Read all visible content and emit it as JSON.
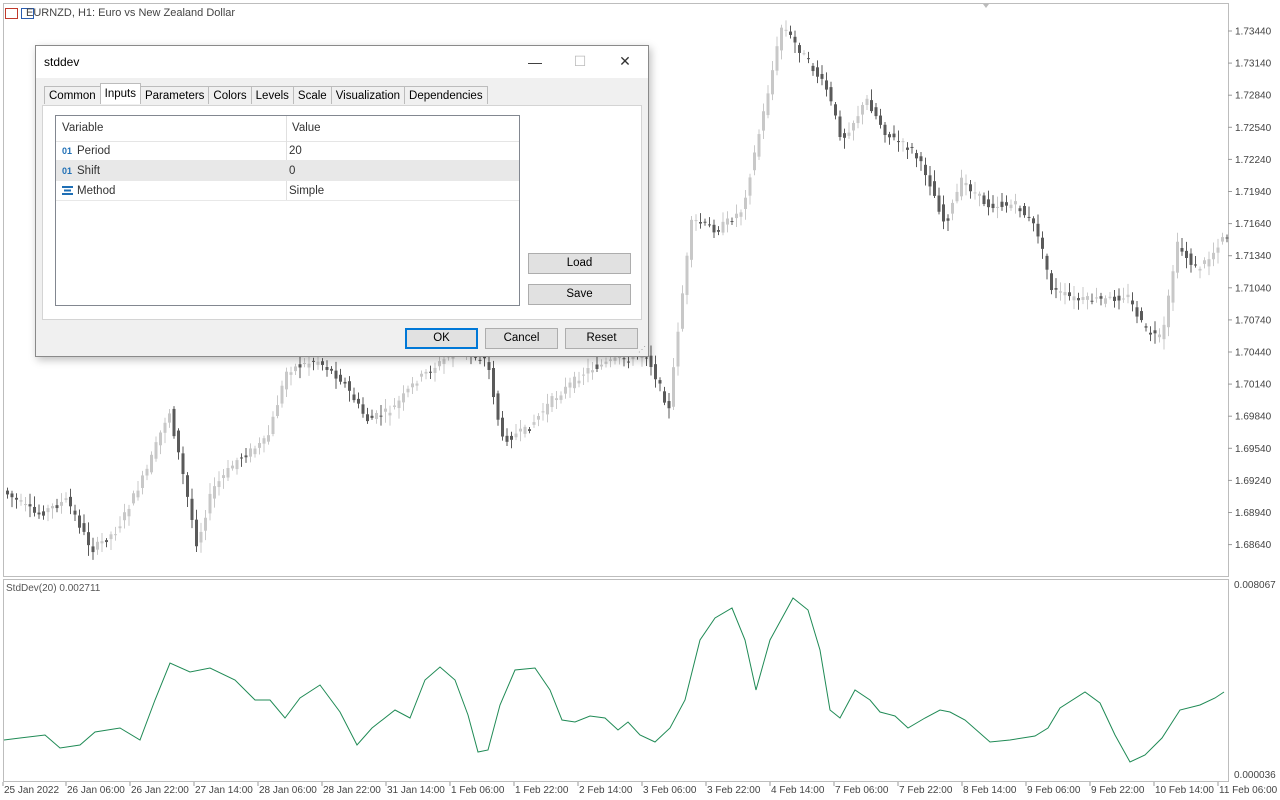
{
  "chart": {
    "symbol_title": "EURNZD, H1:  Euro vs New Zealand Dollar",
    "price_axis_labels": [
      "1.73440",
      "1.73140",
      "1.72840",
      "1.72540",
      "1.72240",
      "1.71940",
      "1.71640",
      "1.71340",
      "1.71040",
      "1.70740",
      "1.70440",
      "1.70140",
      "1.69840",
      "1.69540",
      "1.69240",
      "1.68940",
      "1.68640"
    ],
    "indicator_label": "StdDev(20) 0.002711",
    "indicator_axis_max": "0.008067",
    "indicator_axis_min": "0.000036",
    "time_labels": [
      "25 Jan 2022",
      "26 Jan 06:00",
      "26 Jan 22:00",
      "27 Jan 14:00",
      "28 Jan 06:00",
      "28 Jan 22:00",
      "31 Jan 14:00",
      "1 Feb 06:00",
      "1 Feb 22:00",
      "2 Feb 14:00",
      "3 Feb 06:00",
      "3 Feb 22:00",
      "4 Feb 14:00",
      "7 Feb 06:00",
      "7 Feb 22:00",
      "8 Feb 14:00",
      "9 Feb 06:00",
      "9 Feb 22:00",
      "10 Feb 14:00",
      "11 Feb 06:00"
    ],
    "colors": {
      "up": "#c8c8c8",
      "down": "#5a5a5a",
      "indicator_line": "#1f8a55",
      "grid_border": "#c8c8c8"
    }
  },
  "dialog": {
    "title": "stddev",
    "tabs": [
      "Common",
      "Inputs",
      "Parameters",
      "Colors",
      "Levels",
      "Scale",
      "Visualization",
      "Dependencies"
    ],
    "active_tab": "Inputs",
    "table": {
      "headers": [
        "Variable",
        "Value"
      ],
      "rows": [
        {
          "icon": "int-icon",
          "icon_text": "01",
          "variable": "Period",
          "value": "20"
        },
        {
          "icon": "int-icon",
          "icon_text": "01",
          "variable": "Shift",
          "value": "0"
        },
        {
          "icon": "enum-icon",
          "icon_text": "",
          "variable": "Method",
          "value": "Simple"
        }
      ]
    },
    "buttons": {
      "load": "Load",
      "save": "Save",
      "ok": "OK",
      "cancel": "Cancel",
      "reset": "Reset"
    },
    "window_controls": {
      "minimize": "—",
      "maximize": "☐",
      "close": "✕"
    }
  }
}
